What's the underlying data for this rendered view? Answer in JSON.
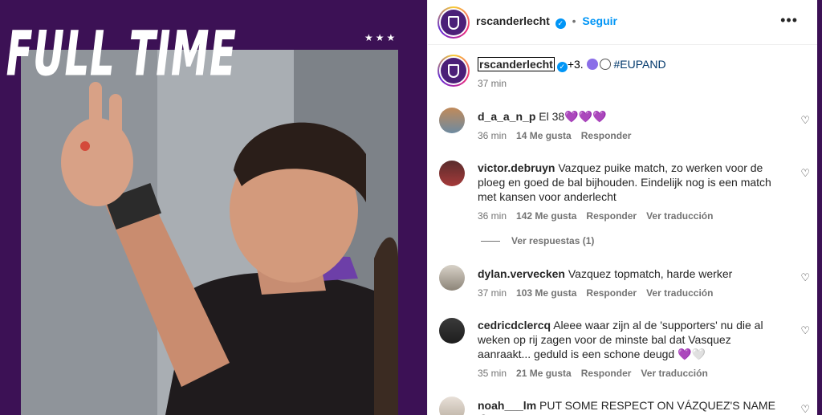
{
  "media": {
    "title": "FULL TIME",
    "stars": "★★★"
  },
  "header": {
    "username": "rscanderlecht",
    "separator": "•",
    "follow_label": "Seguir",
    "more_label": "•••"
  },
  "caption": {
    "username": "rscanderlecht",
    "text": "+3. ",
    "hashtag": "#EUPAND",
    "time": "37 min"
  },
  "comments": [
    {
      "username": "d_a_a_n_p",
      "text": "El 38",
      "emoji": "💜💜💜",
      "time": "36 min",
      "likes": "14 Me gusta",
      "reply": "Responder",
      "translate": ""
    },
    {
      "username": "victor.debruyn",
      "text": "Vazquez puike match, zo werken voor de ploeg en goed de bal bijhouden. Eindelijk nog is een match met kansen voor anderlecht",
      "emoji": "",
      "time": "36 min",
      "likes": "142 Me gusta",
      "reply": "Responder",
      "translate": "Ver traducción"
    },
    {
      "username": "dylan.vervecken",
      "text": "Vazquez topmatch, harde werker",
      "emoji": "",
      "time": "37 min",
      "likes": "103 Me gusta",
      "reply": "Responder",
      "translate": "Ver traducción"
    },
    {
      "username": "cedricdclercq",
      "text": "Aleee waar zijn al de 'supporters' nu die al weken op rij zagen voor de minste bal dat Vasquez aanraakt... geduld is een schone deugd",
      "emoji": "💜🤍",
      "time": "35 min",
      "likes": "21 Me gusta",
      "reply": "Responder",
      "translate": "Ver traducción"
    },
    {
      "username": "noah___lm",
      "text": "PUT SOME RESPECT ON VÁZQUEZ'S NAME",
      "emoji": "😮",
      "time": "",
      "likes": "",
      "reply": "",
      "translate": ""
    }
  ],
  "replies_label": "Ver respuestas (1)",
  "icons": {
    "verified": "verified-badge-icon",
    "heart": "heart-outline-icon",
    "more": "more-horizontal-icon"
  },
  "colors": {
    "accent": "#0095f6",
    "brand_purple": "#3c1155",
    "muted": "#737373"
  }
}
